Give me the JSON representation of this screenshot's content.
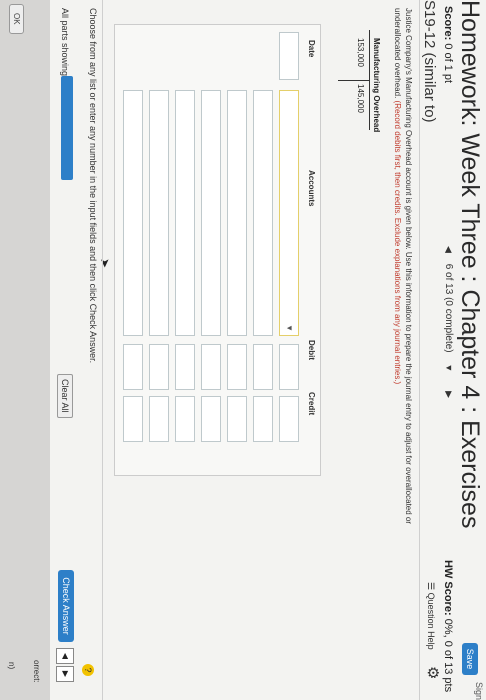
{
  "header": {
    "title": "Homework: Week Three : Chapter 4 : Exercises",
    "save_label": "Save",
    "sign_label": "Sign"
  },
  "status": {
    "score_label": "Score:",
    "score_value": "0 of 1 pt",
    "progress_text": "6 of 13 (0 complete)",
    "hw_score_label": "HW Score:",
    "hw_score_value": "0%, 0 of 13 pts"
  },
  "question": {
    "id": "S19-12 (similar to)",
    "help_label": "Question Help",
    "instructions": "Justice Company's Manufacturing Overhead account is given below. Use this information to prepare the journal entry to adjust for overallocated or underallocated overhead.",
    "instructions_red": "(Record debits first, then credits. Exclude explanations from any journal entries.)",
    "t_account": {
      "title": "Manufacturing Overhead",
      "debit": "153,000",
      "credit": "145,000"
    }
  },
  "journal": {
    "columns": [
      "Date",
      "Accounts",
      "Debit",
      "Credit"
    ],
    "rows": 7
  },
  "footer": {
    "choose_text": "Choose from any list or enter any number in the input fields and then click Check Answer.",
    "parts_label": "All parts showing",
    "clear_label": "Clear All",
    "check_label": "Check Answer",
    "ok_label": "OK",
    "edge_text_1": "orrect:",
    "edge_text_2": "n)"
  },
  "colors": {
    "accent": "#2d7fc8",
    "help": "#f2c200"
  }
}
